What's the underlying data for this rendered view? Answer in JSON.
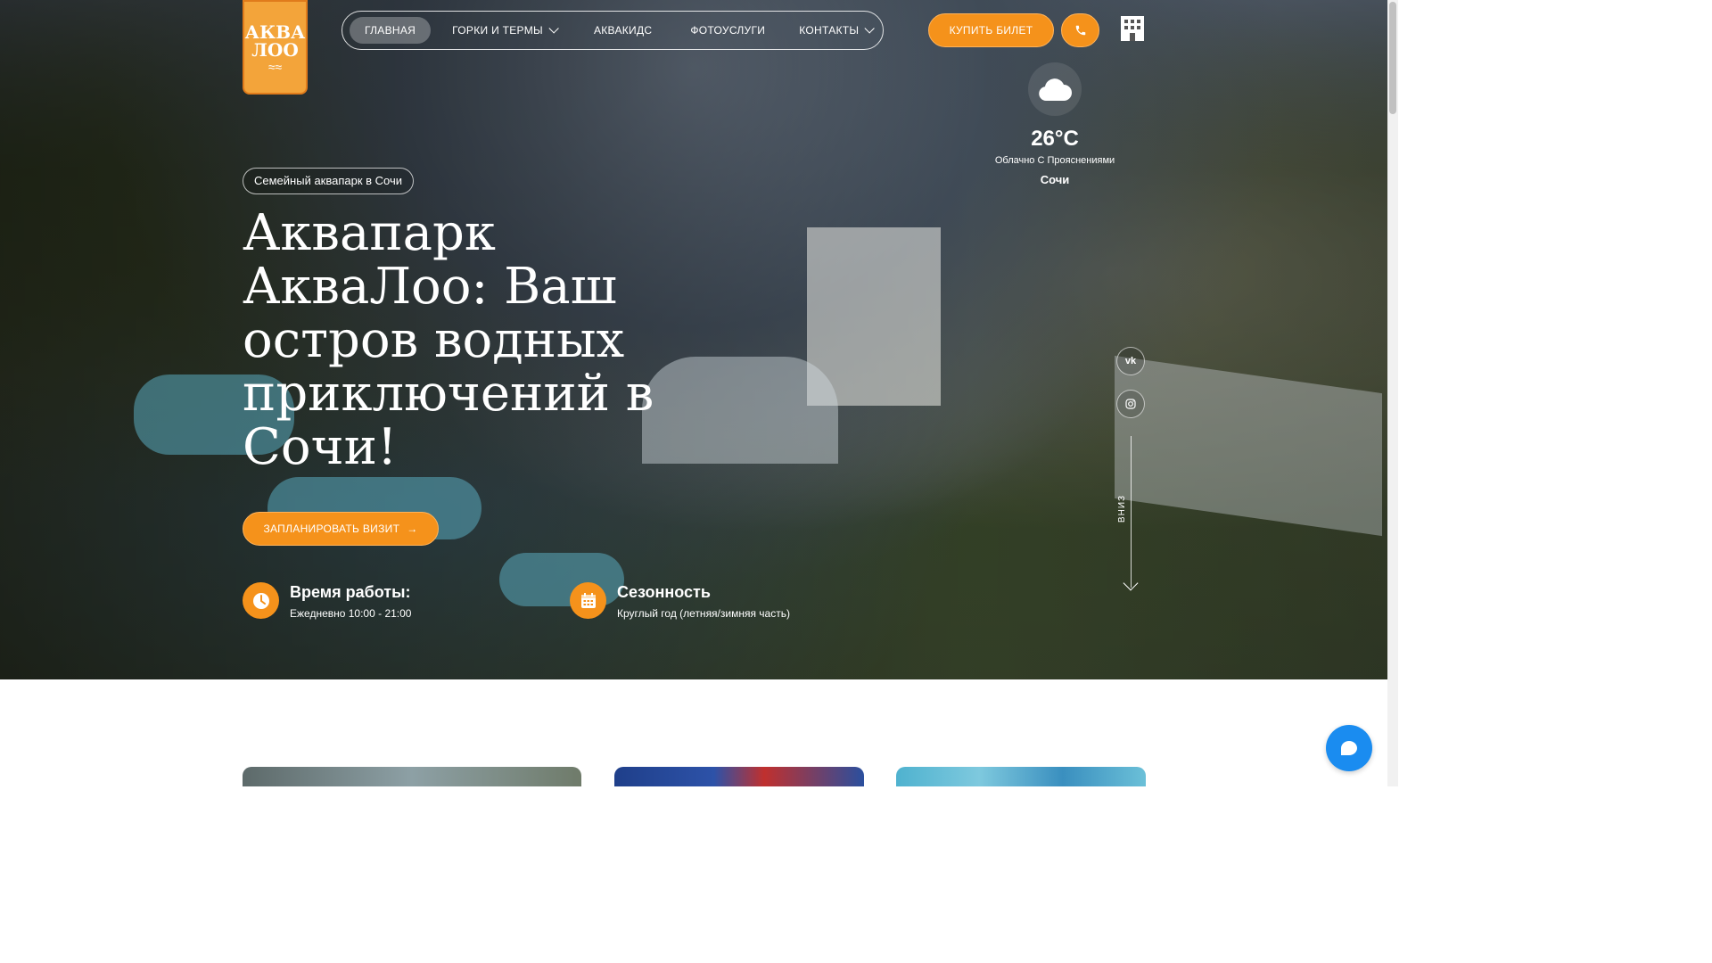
{
  "logo": {
    "line1": "АКВА",
    "line2": "ЛОО",
    "waves": "≈≈"
  },
  "nav": {
    "items": [
      {
        "label": "ГЛАВНАЯ",
        "active": true,
        "dropdown": false
      },
      {
        "label": "ГОРКИ И ТЕРМЫ",
        "active": false,
        "dropdown": true
      },
      {
        "label": "АКВАКИДС",
        "active": false,
        "dropdown": false
      },
      {
        "label": "ФОТОУСЛУГИ",
        "active": false,
        "dropdown": false
      },
      {
        "label": "КОНТАКТЫ",
        "active": false,
        "dropdown": true
      }
    ]
  },
  "header": {
    "buy_ticket": "КУПИТЬ БИЛЕТ",
    "phone_icon": "phone-icon",
    "building_icon": "building-icon"
  },
  "weather": {
    "icon": "cloud-icon",
    "temperature": "26°C",
    "description": "Облачно С Прояснениями",
    "city": "Сочи"
  },
  "hero": {
    "tag": "Семейный аквапарк в Сочи",
    "headline": "Аквапарк АкваЛоо: Ваш остров водных приключений в Сочи!",
    "cta": "ЗАПЛАНИРОВАТЬ ВИЗИТ",
    "cta_arrow": "→"
  },
  "info": {
    "hours": {
      "icon": "clock-icon",
      "title": "Время работы:",
      "text": "Ежедневно 10:00 - 21:00"
    },
    "season": {
      "icon": "calendar-icon",
      "title": "Сезонность",
      "text": "Круглый год (летняя/зимняя часть)"
    }
  },
  "social": {
    "vk": "vk",
    "instagram": "instagram-icon"
  },
  "scroll_down": {
    "label": "ВНИЗ"
  },
  "colors": {
    "accent": "#f5921b",
    "chat": "#1a8cf0"
  }
}
